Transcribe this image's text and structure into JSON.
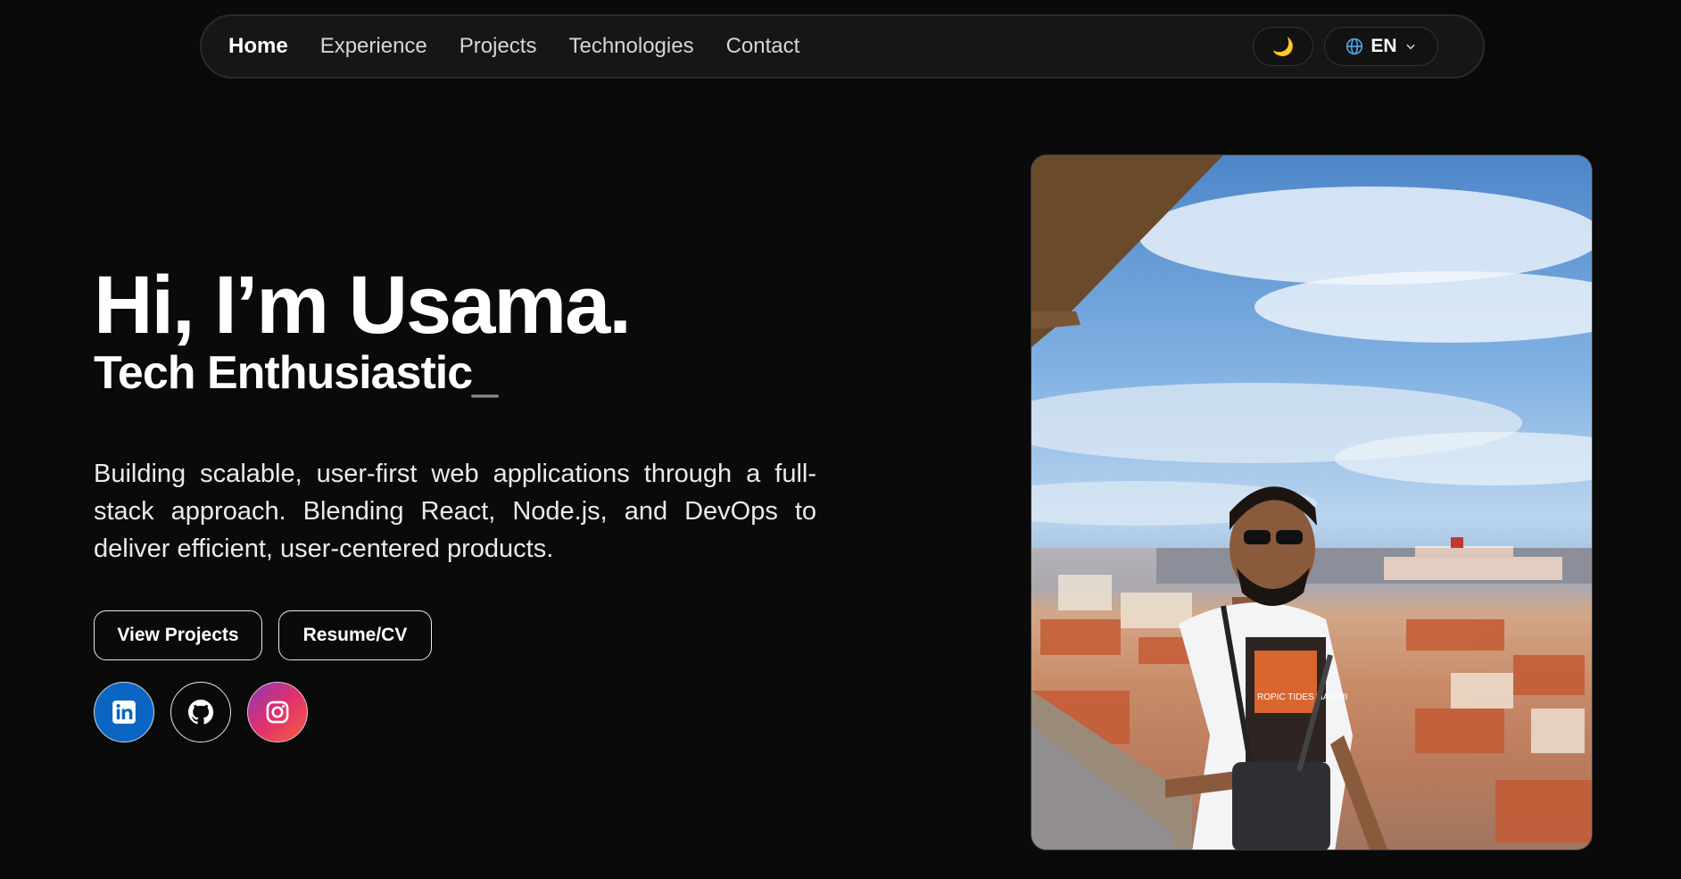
{
  "nav": {
    "links": [
      "Home",
      "Experience",
      "Projects",
      "Technologies",
      "Contact"
    ],
    "active": "Home",
    "theme_icon": "moon-icon",
    "language": "EN"
  },
  "hero": {
    "title": "Hi, I’m Usama.",
    "subtitle": "Tech Enthusiastic",
    "cursor": "_",
    "description": "Building scalable, user-first web applications through a full-stack approach. Blending React, Node.js, and DevOps to deliver efficient, user-centered products."
  },
  "buttons": {
    "view_projects": "View Projects",
    "resume": "Resume/CV"
  },
  "social": {
    "icons": [
      "linkedin-icon",
      "github-icon",
      "instagram-icon"
    ]
  },
  "photo": {
    "shirt_text": "ROPIC TIDES HAWAII"
  },
  "colors": {
    "background": "#0a0a0a",
    "linkedin": "#0a66c2",
    "instagram_start": "#8a3ab9",
    "instagram_end": "#f56040"
  }
}
